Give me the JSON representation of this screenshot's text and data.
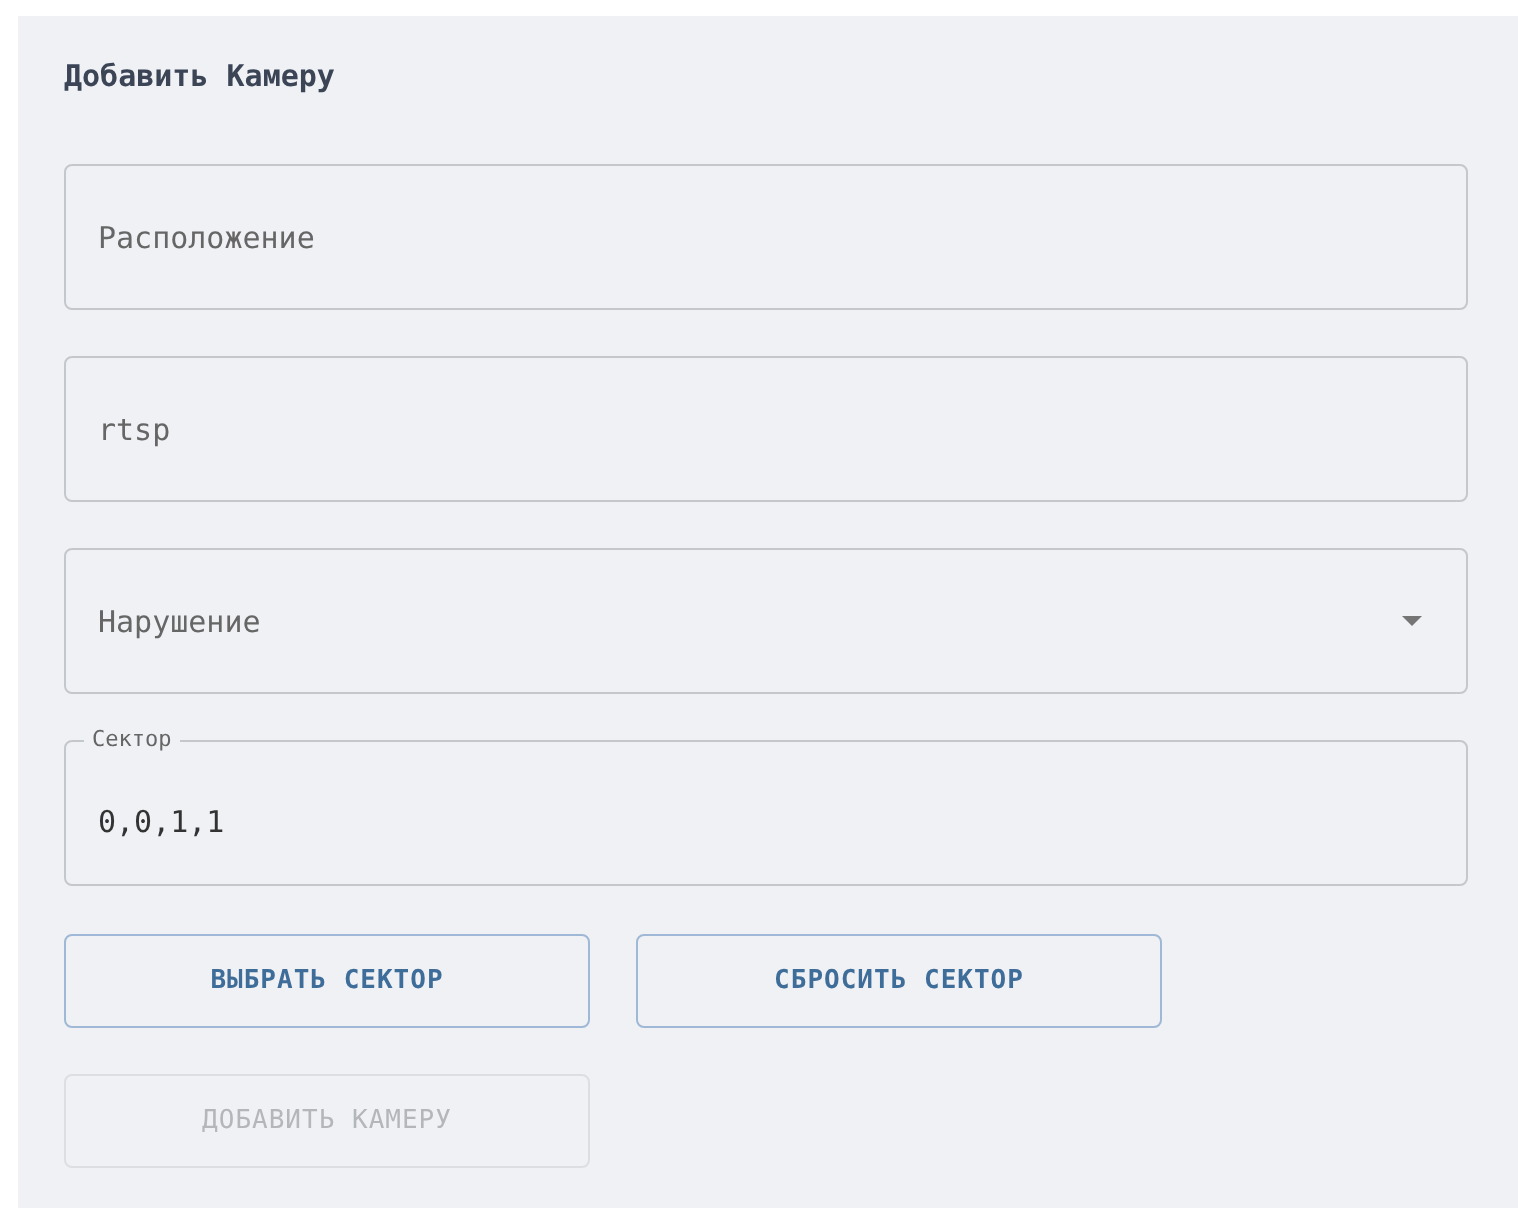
{
  "title": "Добавить Камеру",
  "fields": [
    {
      "kind": "text",
      "placeholder": "Расположение"
    },
    {
      "kind": "text",
      "placeholder": "rtsp"
    },
    {
      "kind": "select",
      "placeholder": "Нарушение"
    },
    {
      "kind": "text",
      "label": "Сектор",
      "value": "0,0,1,1"
    }
  ],
  "buttons": [
    {
      "label": "ВЫБРАТЬ СЕКТОР",
      "disabled": false
    },
    {
      "label": "СБРОСИТЬ СЕКТОР",
      "disabled": false
    },
    {
      "label": "ДОБАВИТЬ КАМЕРУ",
      "disabled": true
    }
  ]
}
